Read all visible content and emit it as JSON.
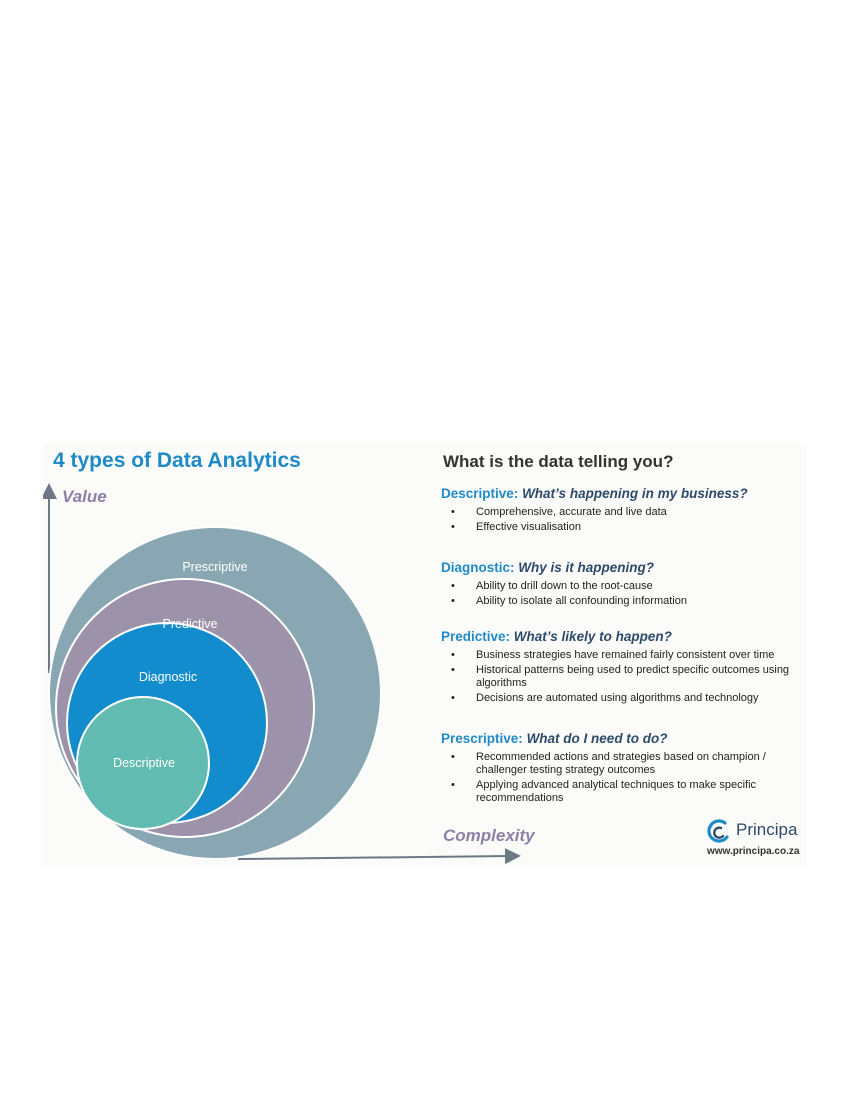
{
  "left": {
    "title": "4 types of Data Analytics",
    "axis_y_label": "Value",
    "axis_x_label": "Complexity",
    "circles": [
      {
        "label": "Prescriptive",
        "color": "#88a7b2"
      },
      {
        "label": "Predictive",
        "color": "#9c92a9"
      },
      {
        "label": "Diagnostic",
        "color": "#128ccc"
      },
      {
        "label": "Descriptive",
        "color": "#62bbb0"
      }
    ]
  },
  "right": {
    "title": "What is the data telling you?",
    "sections": [
      {
        "name": "Descriptive:",
        "question": "What’s happening in my business?",
        "bullets": [
          "Comprehensive, accurate and live data",
          "Effective visualisation"
        ]
      },
      {
        "name": "Diagnostic:",
        "question": "Why is it happening?",
        "bullets": [
          "Ability to drill down to the root-cause",
          "Ability to isolate all confounding information"
        ]
      },
      {
        "name": "Predictive:",
        "question": "What’s likely to happen?",
        "bullets": [
          "Business strategies have remained fairly consistent over time",
          "Historical patterns being used to predict specific outcomes using algorithms",
          "Decisions are automated using algorithms and technology"
        ]
      },
      {
        "name": "Prescriptive:",
        "question": "What do I need to do?",
        "bullets": [
          "Recommended actions and strategies based on champion / challenger testing strategy outcomes",
          "Applying advanced analytical techniques to make specific recommendations"
        ]
      }
    ]
  },
  "logo": {
    "name": "Principa",
    "url": "www.principa.co.za",
    "icon": "principa-swirl-icon",
    "color": "#1f8ac8"
  }
}
